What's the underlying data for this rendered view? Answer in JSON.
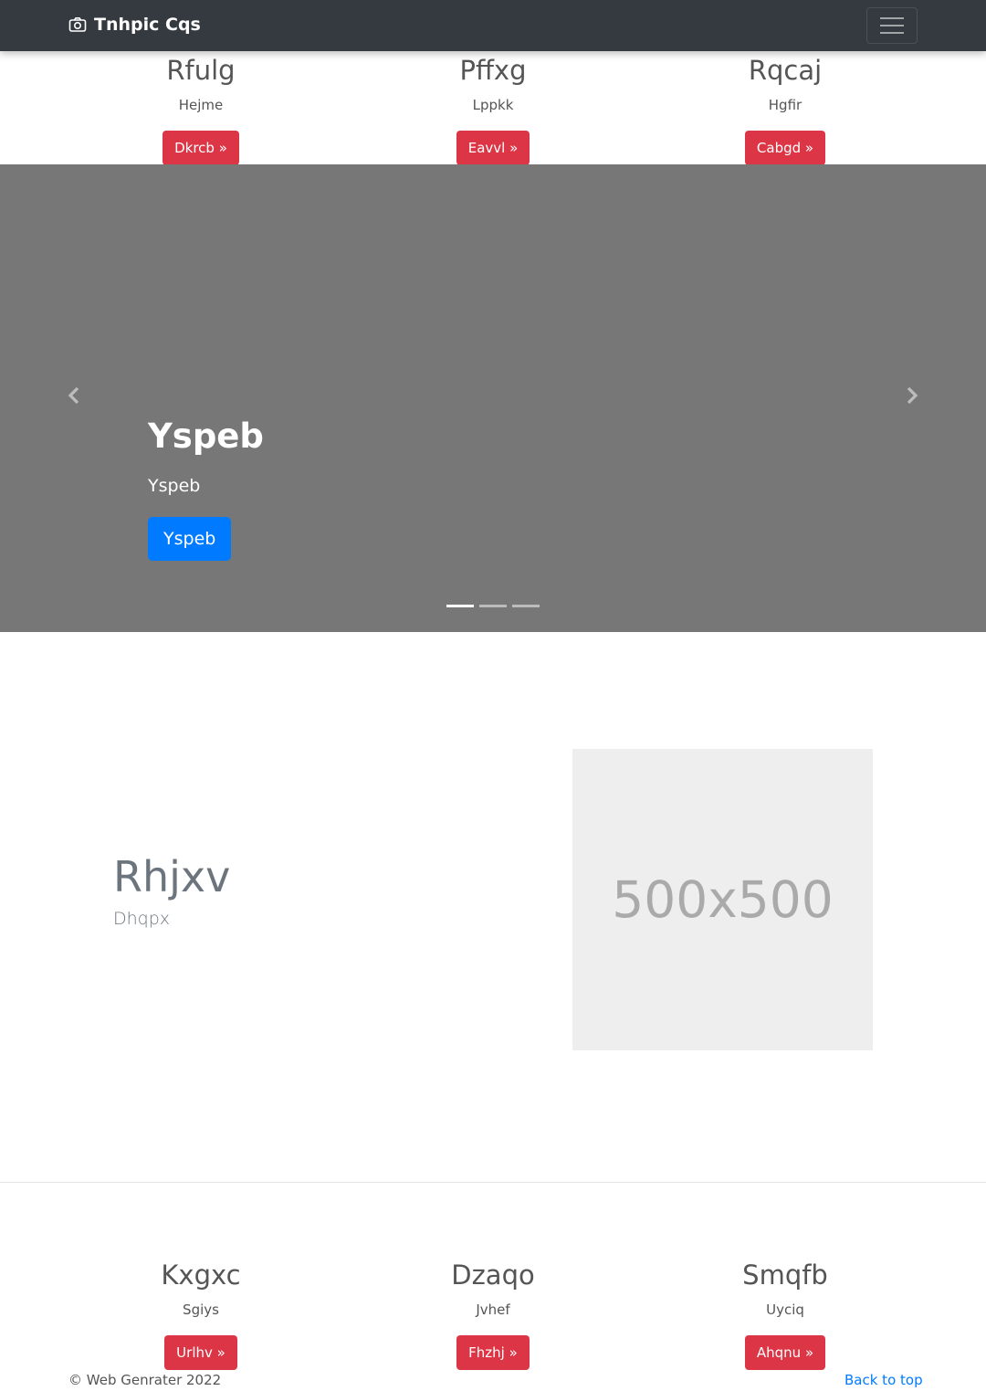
{
  "navbar": {
    "brand": "Tnhpic Cqs",
    "brand_icon": "camera-icon",
    "toggler_icon": "hamburger-menu-icon"
  },
  "top_features": [
    {
      "title": "Rfulg",
      "text": "Hejme",
      "button": "Dkrcb »"
    },
    {
      "title": "Pffxg",
      "text": "Lppkk",
      "button": "Eavvl »"
    },
    {
      "title": "Rqcaj",
      "text": "Hgfir",
      "button": "Cabgd »"
    }
  ],
  "carousel": {
    "heading": "Yspeb",
    "text": "Yspeb",
    "button": "Yspeb",
    "slide_count": 3,
    "active_slide": 1,
    "prev_icon": "chevron-left-icon",
    "next_icon": "chevron-right-icon"
  },
  "featurette": {
    "heading": "Rhjxv",
    "subheading": "Dhqpx",
    "image_label": "500x500"
  },
  "bottom_features": [
    {
      "title": "Kxgxc",
      "text": "Sgiys",
      "button": "Urlhv »"
    },
    {
      "title": "Dzaqo",
      "text": "Jvhef",
      "button": "Fhzhj »"
    },
    {
      "title": "Smqfb",
      "text": "Uyciq",
      "button": "Ahqnu »"
    }
  ],
  "footer": {
    "copyright": "© Web Genrater 2022",
    "back_to_top": "Back to top"
  },
  "colors": {
    "navbar": "#343a40",
    "danger": "#dc3545",
    "primary": "#007bff",
    "carousel_bg": "#777777"
  }
}
